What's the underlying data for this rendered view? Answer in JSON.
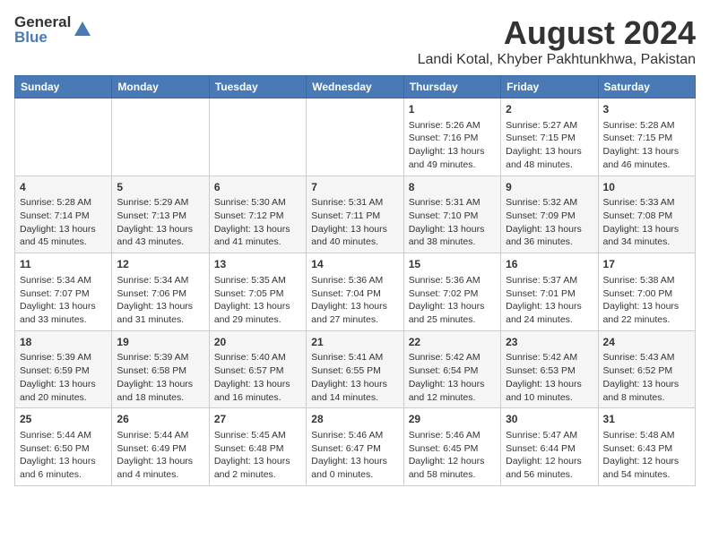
{
  "header": {
    "logo_line1": "General",
    "logo_line2": "Blue",
    "title": "August 2024",
    "subtitle": "Landi Kotal, Khyber Pakhtunkhwa, Pakistan"
  },
  "days_of_week": [
    "Sunday",
    "Monday",
    "Tuesday",
    "Wednesday",
    "Thursday",
    "Friday",
    "Saturday"
  ],
  "weeks": [
    [
      {
        "day": "",
        "info": ""
      },
      {
        "day": "",
        "info": ""
      },
      {
        "day": "",
        "info": ""
      },
      {
        "day": "",
        "info": ""
      },
      {
        "day": "1",
        "info": "Sunrise: 5:26 AM\nSunset: 7:16 PM\nDaylight: 13 hours\nand 49 minutes."
      },
      {
        "day": "2",
        "info": "Sunrise: 5:27 AM\nSunset: 7:15 PM\nDaylight: 13 hours\nand 48 minutes."
      },
      {
        "day": "3",
        "info": "Sunrise: 5:28 AM\nSunset: 7:15 PM\nDaylight: 13 hours\nand 46 minutes."
      }
    ],
    [
      {
        "day": "4",
        "info": "Sunrise: 5:28 AM\nSunset: 7:14 PM\nDaylight: 13 hours\nand 45 minutes."
      },
      {
        "day": "5",
        "info": "Sunrise: 5:29 AM\nSunset: 7:13 PM\nDaylight: 13 hours\nand 43 minutes."
      },
      {
        "day": "6",
        "info": "Sunrise: 5:30 AM\nSunset: 7:12 PM\nDaylight: 13 hours\nand 41 minutes."
      },
      {
        "day": "7",
        "info": "Sunrise: 5:31 AM\nSunset: 7:11 PM\nDaylight: 13 hours\nand 40 minutes."
      },
      {
        "day": "8",
        "info": "Sunrise: 5:31 AM\nSunset: 7:10 PM\nDaylight: 13 hours\nand 38 minutes."
      },
      {
        "day": "9",
        "info": "Sunrise: 5:32 AM\nSunset: 7:09 PM\nDaylight: 13 hours\nand 36 minutes."
      },
      {
        "day": "10",
        "info": "Sunrise: 5:33 AM\nSunset: 7:08 PM\nDaylight: 13 hours\nand 34 minutes."
      }
    ],
    [
      {
        "day": "11",
        "info": "Sunrise: 5:34 AM\nSunset: 7:07 PM\nDaylight: 13 hours\nand 33 minutes."
      },
      {
        "day": "12",
        "info": "Sunrise: 5:34 AM\nSunset: 7:06 PM\nDaylight: 13 hours\nand 31 minutes."
      },
      {
        "day": "13",
        "info": "Sunrise: 5:35 AM\nSunset: 7:05 PM\nDaylight: 13 hours\nand 29 minutes."
      },
      {
        "day": "14",
        "info": "Sunrise: 5:36 AM\nSunset: 7:04 PM\nDaylight: 13 hours\nand 27 minutes."
      },
      {
        "day": "15",
        "info": "Sunrise: 5:36 AM\nSunset: 7:02 PM\nDaylight: 13 hours\nand 25 minutes."
      },
      {
        "day": "16",
        "info": "Sunrise: 5:37 AM\nSunset: 7:01 PM\nDaylight: 13 hours\nand 24 minutes."
      },
      {
        "day": "17",
        "info": "Sunrise: 5:38 AM\nSunset: 7:00 PM\nDaylight: 13 hours\nand 22 minutes."
      }
    ],
    [
      {
        "day": "18",
        "info": "Sunrise: 5:39 AM\nSunset: 6:59 PM\nDaylight: 13 hours\nand 20 minutes."
      },
      {
        "day": "19",
        "info": "Sunrise: 5:39 AM\nSunset: 6:58 PM\nDaylight: 13 hours\nand 18 minutes."
      },
      {
        "day": "20",
        "info": "Sunrise: 5:40 AM\nSunset: 6:57 PM\nDaylight: 13 hours\nand 16 minutes."
      },
      {
        "day": "21",
        "info": "Sunrise: 5:41 AM\nSunset: 6:55 PM\nDaylight: 13 hours\nand 14 minutes."
      },
      {
        "day": "22",
        "info": "Sunrise: 5:42 AM\nSunset: 6:54 PM\nDaylight: 13 hours\nand 12 minutes."
      },
      {
        "day": "23",
        "info": "Sunrise: 5:42 AM\nSunset: 6:53 PM\nDaylight: 13 hours\nand 10 minutes."
      },
      {
        "day": "24",
        "info": "Sunrise: 5:43 AM\nSunset: 6:52 PM\nDaylight: 13 hours\nand 8 minutes."
      }
    ],
    [
      {
        "day": "25",
        "info": "Sunrise: 5:44 AM\nSunset: 6:50 PM\nDaylight: 13 hours\nand 6 minutes."
      },
      {
        "day": "26",
        "info": "Sunrise: 5:44 AM\nSunset: 6:49 PM\nDaylight: 13 hours\nand 4 minutes."
      },
      {
        "day": "27",
        "info": "Sunrise: 5:45 AM\nSunset: 6:48 PM\nDaylight: 13 hours\nand 2 minutes."
      },
      {
        "day": "28",
        "info": "Sunrise: 5:46 AM\nSunset: 6:47 PM\nDaylight: 13 hours\nand 0 minutes."
      },
      {
        "day": "29",
        "info": "Sunrise: 5:46 AM\nSunset: 6:45 PM\nDaylight: 12 hours\nand 58 minutes."
      },
      {
        "day": "30",
        "info": "Sunrise: 5:47 AM\nSunset: 6:44 PM\nDaylight: 12 hours\nand 56 minutes."
      },
      {
        "day": "31",
        "info": "Sunrise: 5:48 AM\nSunset: 6:43 PM\nDaylight: 12 hours\nand 54 minutes."
      }
    ]
  ]
}
